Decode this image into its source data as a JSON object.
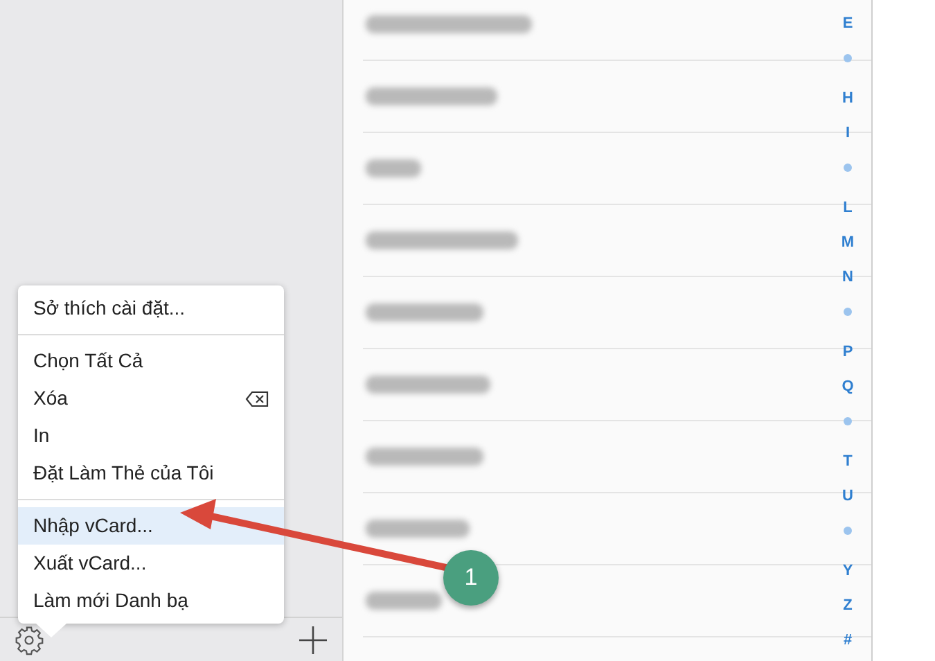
{
  "contacts": [
    {
      "kind": "blurred"
    },
    {
      "kind": "blurred"
    },
    {
      "kind": "blurred"
    },
    {
      "kind": "blurred"
    },
    {
      "kind": "blurred"
    },
    {
      "kind": "blurred"
    },
    {
      "kind": "blurred"
    },
    {
      "kind": "blurred"
    },
    {
      "kind": "blurred"
    }
  ],
  "index": [
    {
      "kind": "letter",
      "label": "E"
    },
    {
      "kind": "dot"
    },
    {
      "kind": "letter",
      "label": "H"
    },
    {
      "kind": "letter",
      "label": "I"
    },
    {
      "kind": "dot"
    },
    {
      "kind": "letter",
      "label": "L"
    },
    {
      "kind": "letter",
      "label": "M"
    },
    {
      "kind": "letter",
      "label": "N"
    },
    {
      "kind": "dot"
    },
    {
      "kind": "letter",
      "label": "P"
    },
    {
      "kind": "letter",
      "label": "Q"
    },
    {
      "kind": "dot"
    },
    {
      "kind": "letter",
      "label": "T"
    },
    {
      "kind": "letter",
      "label": "U"
    },
    {
      "kind": "dot"
    },
    {
      "kind": "letter",
      "label": "Y"
    },
    {
      "kind": "letter",
      "label": "Z"
    },
    {
      "kind": "letter",
      "label": "#"
    }
  ],
  "menu": {
    "groups": [
      [
        {
          "label": "Sở thích cài đặt...",
          "selected": false
        }
      ],
      [
        {
          "label": "Chọn Tất Cả",
          "selected": false
        },
        {
          "label": "Xóa",
          "selected": false,
          "delete_key": true
        },
        {
          "label": "In",
          "selected": false
        },
        {
          "label": "Đặt Làm Thẻ của Tôi",
          "selected": false
        }
      ],
      [
        {
          "label": "Nhập vCard...",
          "selected": true
        },
        {
          "label": "Xuất vCard...",
          "selected": false
        },
        {
          "label": "Làm mới Danh bạ",
          "selected": false
        }
      ]
    ]
  },
  "callout": {
    "label": "1"
  }
}
